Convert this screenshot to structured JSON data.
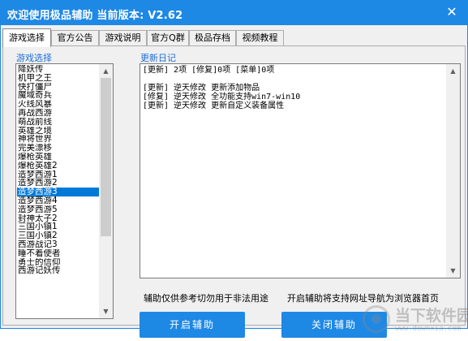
{
  "window": {
    "title": "欢迎使用极品辅助  当前版本: V2.62",
    "close_glyph": "✕"
  },
  "tabs": [
    {
      "label": "游戏选择",
      "active": true
    },
    {
      "label": "官方公告",
      "active": false
    },
    {
      "label": "游戏说明",
      "active": false
    },
    {
      "label": "官方Q群",
      "active": false
    },
    {
      "label": "极品存档",
      "active": false
    },
    {
      "label": "视频教程",
      "active": false
    }
  ],
  "game_list": {
    "label": "游戏选择",
    "selected": "造梦西游3",
    "items": [
      "降妖传",
      "机甲之王",
      "快打僵尸",
      "魔域奇兵",
      "火线风暴",
      "再战西游",
      "萌战前线",
      "英雄之境",
      "神将世界",
      "完美漂移",
      "爆枪英雄",
      "爆枪英雄2",
      "造梦西游1",
      "造梦西游2",
      "造梦西游3",
      "造梦西游4",
      "造梦西游5",
      "封神太子2",
      "三国小镇1",
      "三国小镇2",
      "西游战记3",
      "睡不着使者",
      "勇士的信仰",
      "西游记妖传"
    ]
  },
  "update_log": {
    "label": "更新日记",
    "lines": [
      "[更新] 2项 [修复]0项 [菜单]0项",
      "",
      "[更新] 逆天修改 更新添加物品",
      "[修复] 逆天修改 全功能支持win7-win10",
      "[更新] 逆天修改 更新自定义装备属性"
    ]
  },
  "notes": {
    "left": "辅助仅供参考切勿用于非法用途",
    "right": "开启辅助将支持网址导航为浏览器首页"
  },
  "buttons": {
    "start": "开启辅助",
    "stop": "关闭辅助"
  },
  "watermark": {
    "text": "当下软件园",
    "url": "www.downxia.com"
  },
  "icons": {
    "scroll_up": "scroll-up-icon",
    "scroll_down": "scroll-down-icon"
  },
  "colors": {
    "accent": "#1e88e5",
    "selection": "#0078d7",
    "group_label": "#1e6fd9"
  }
}
